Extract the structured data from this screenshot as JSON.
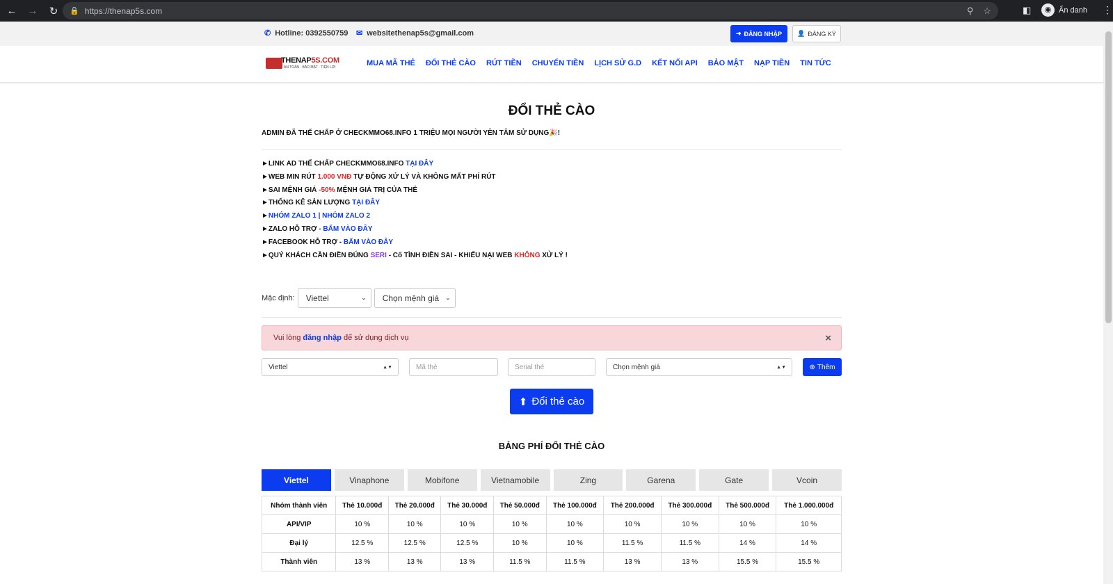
{
  "browser": {
    "url": "https://thenap5s.com",
    "profile_label": "Ẩn danh"
  },
  "topbar": {
    "hotline": "Hotline: 0392550759",
    "email": "websitethenap5s@gmail.com",
    "login_label": "ĐĂNG NHẬP",
    "register_label": "ĐĂNG KÝ"
  },
  "logo": {
    "text_a": "THENAP",
    "text_b": "5S.COM",
    "tagline": "AN TOÀN · BẢO MẬT · TIỆN LỢI"
  },
  "nav": {
    "items": [
      "MUA MÃ THẺ",
      "ĐỔI THẺ CÀO",
      "RÚT TIỀN",
      "CHUYỂN TIỀN",
      "LỊCH SỬ G.D",
      "KẾT NỐI API",
      "BẢO MẬT",
      "NẠP TIỀN",
      "TIN TỨC"
    ]
  },
  "page": {
    "title": "ĐỔI THẺ CÀO",
    "notice": "ADMIN ĐÃ THẾ CHẤP Ở CHECKMMO68.INFO 1 TRIỆU MỌI NGƯỜI YÊN TÂM SỬ DỤNG🎉!",
    "lines": {
      "l1_text": "►LINK AD THẾ CHẤP CHECKMMO68.INFO ",
      "l1_link": "TẠI ĐÂY",
      "l2_a": "►WEB MIN RÚT ",
      "l2_red": "1.000 VNĐ",
      "l2_b": " TỰ ĐỘNG XỬ LÝ VÀ KHÔNG MẤT PHÍ RÚT",
      "l3_a": "►SAI MỆNH GIÁ ",
      "l3_red": "-50%",
      "l3_b": " MỆNH GIÁ TRỊ CỦA THẺ",
      "l4_a": "►THỐNG KÊ SẢN LƯỢNG ",
      "l4_link": "TẠI ĐÂY",
      "l5_a": "►",
      "l5_link1": "NHÓM ZALO 1",
      "l5_sep": " | ",
      "l5_link2": "NHÓM ZALO 2",
      "l6_a": "►ZALO HỖ TRỢ - ",
      "l6_link": "BẤM VÀO ĐÂY",
      "l7_a": "►FACEBOOK HỖ TRỢ - ",
      "l7_link": "BẤM VÀO ĐÂY",
      "l8_a": "►QUÝ KHÁCH CẦN ĐIỀN ĐÚNG ",
      "l8_purple": "SERI",
      "l8_b": " - Cố TÌNH ĐIỀN SAI - KHIẾU NẠI WEB ",
      "l8_red": "KHÔNG",
      "l8_c": " XỬ LÝ !"
    }
  },
  "defaults": {
    "label": "Mặc định:",
    "telco_value": "Viettel",
    "amount_value": "Chọn mệnh giá"
  },
  "alert": {
    "text_a": "Vui lòng ",
    "link": "đăng nhập",
    "text_b": " để sử dụng dịch vụ",
    "close": "×"
  },
  "form": {
    "telco_value": "Viettel",
    "code_placeholder": "Mã thẻ",
    "serial_placeholder": "Serial thẻ",
    "amount_value": "Chọn mệnh giá",
    "add_label": "Thêm",
    "submit_label": "Đổi thẻ cào"
  },
  "fee_table": {
    "title": "BẢNG PHÍ ĐỔI THẺ CÀO",
    "tabs": [
      "Viettel",
      "Vinaphone",
      "Mobifone",
      "Vietnamobile",
      "Zing",
      "Garena",
      "Gate",
      "Vcoin"
    ],
    "active_tab": "Viettel",
    "headers": [
      "Nhóm thành viên",
      "Thẻ 10.000đ",
      "Thẻ 20.000đ",
      "Thẻ 30.000đ",
      "Thẻ 50.000đ",
      "Thẻ 100.000đ",
      "Thẻ 200.000đ",
      "Thẻ 300.000đ",
      "Thẻ 500.000đ",
      "Thẻ 1.000.000đ"
    ],
    "rows": [
      [
        "API/VIP",
        "10 %",
        "10 %",
        "10 %",
        "10 %",
        "10 %",
        "10 %",
        "10 %",
        "10 %",
        "10 %"
      ],
      [
        "Đại lý",
        "12.5 %",
        "12.5 %",
        "12.5 %",
        "10 %",
        "10 %",
        "11.5 %",
        "11.5 %",
        "14 %",
        "14 %"
      ],
      [
        "Thành viên",
        "13 %",
        "13 %",
        "13 %",
        "11.5 %",
        "11.5 %",
        "13 %",
        "13 %",
        "15.5 %",
        "15.5 %"
      ]
    ]
  },
  "colors": {
    "primary": "#0c3cf0",
    "danger": "#e02424",
    "alert_bg": "#f8d7da"
  }
}
